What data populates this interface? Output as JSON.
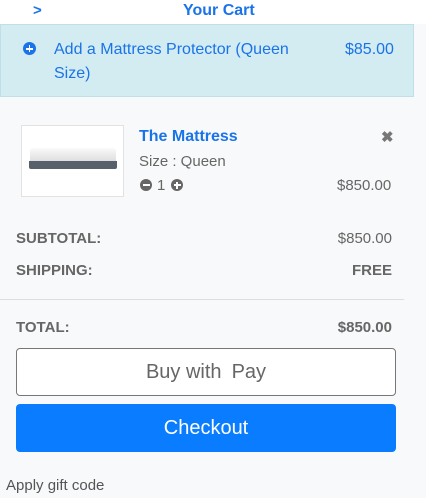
{
  "header": {
    "back_icon": "chevron-right-icon",
    "back_glyph": ">",
    "title": "Your Cart"
  },
  "upsell": {
    "icon": "plus-circle-icon",
    "text": "Add a Mattress Protector (Queen Size)",
    "price": "$85.00",
    "bg_color": "#d3ecf2"
  },
  "item": {
    "name": "The Mattress",
    "size": "Size : Queen",
    "quantity": "1",
    "price": "$850.00",
    "remove_glyph": "✖"
  },
  "totals": {
    "subtotal_label": "SUBTOTAL:",
    "subtotal_value": "$850.00",
    "shipping_label": "SHIPPING:",
    "shipping_value": "FREE",
    "total_label": "TOTAL:",
    "total_value": "$850.00"
  },
  "buttons": {
    "applepay_prefix": "Buy with",
    "applepay_suffix": "Pay",
    "apple_glyph": "",
    "checkout_label": "Checkout",
    "checkout_color": "#0a7cff"
  },
  "gift": {
    "label": "Apply gift code"
  },
  "colors": {
    "accent": "#1a73e8"
  }
}
